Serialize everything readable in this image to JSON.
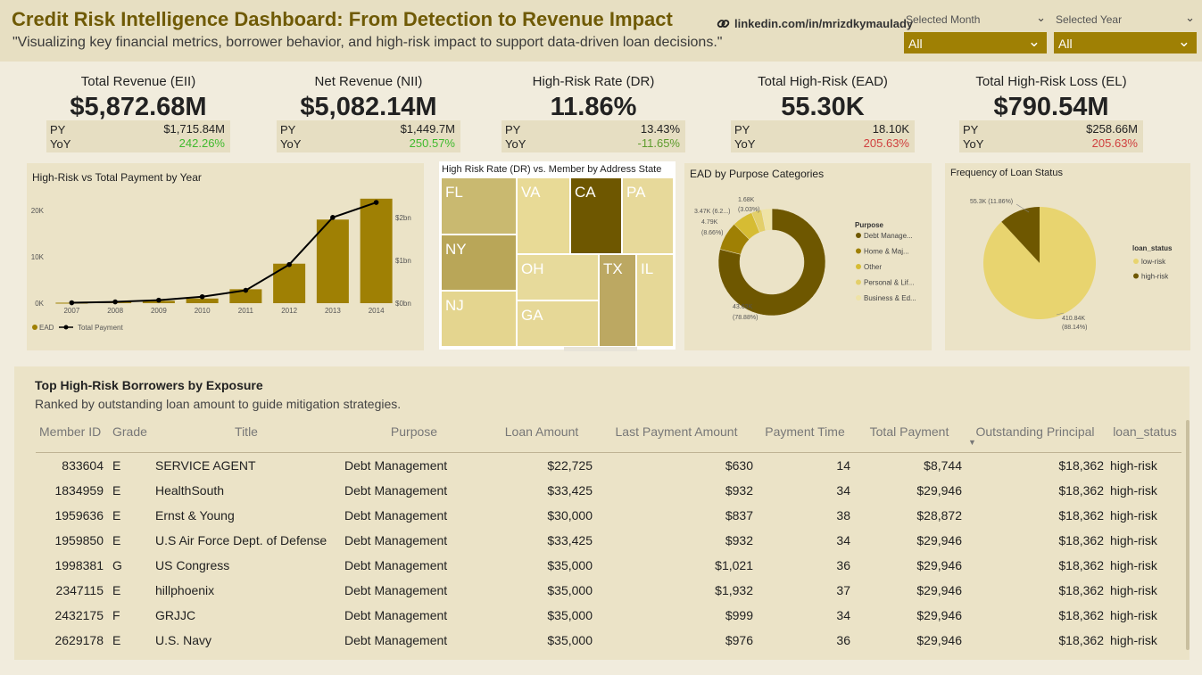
{
  "header": {
    "title": "Credit Risk Intelligence Dashboard: From Detection to Revenue Impact",
    "subtitle": "\"Visualizing key financial metrics, borrower behavior, and high-risk impact to support data-driven loan decisions.\"",
    "link": "linkedin.com/in/mrizdkymaulady"
  },
  "filters": {
    "month": {
      "label": "Selected Month",
      "value": "All"
    },
    "year": {
      "label": "Selected Year",
      "value": "All"
    }
  },
  "kpis": [
    {
      "title": "Total Revenue (EII)",
      "value": "$5,872.68M",
      "py_label": "PY",
      "py": "$1,715.84M",
      "yoy_label": "YoY",
      "yoy": "242.26%",
      "yoy_color": "#3fba2d"
    },
    {
      "title": "Net Revenue (NII)",
      "value": "$5,082.14M",
      "py_label": "PY",
      "py": "$1,449.7M",
      "yoy_label": "YoY",
      "yoy": "250.57%",
      "yoy_color": "#3fba2d"
    },
    {
      "title": "High-Risk Rate (DR)",
      "value": "11.86%",
      "py_label": "PY",
      "py": "13.43%",
      "yoy_label": "YoY",
      "yoy": "-11.65%",
      "yoy_color": "#5e9c2e"
    },
    {
      "title": "Total High-Risk (EAD)",
      "value": "55.30K",
      "py_label": "PY",
      "py": "18.10K",
      "yoy_label": "YoY",
      "yoy": "205.63%",
      "yoy_color": "#d0403f"
    },
    {
      "title": "Total High-Risk Loss (EL)",
      "value": "$790.54M",
      "py_label": "PY",
      "py": "$258.66M",
      "yoy_label": "YoY",
      "yoy": "205.63%",
      "yoy_color": "#d0403f"
    }
  ],
  "charts": {
    "combo_title": "High-Risk vs Total Payment by Year",
    "treemap_title": "High Risk Rate (DR) vs. Member by Address State",
    "donut_title": "EAD by Purpose Categories",
    "pie_title": "Frequency of Loan Status"
  },
  "chart_data": [
    {
      "type": "bar",
      "title": "High-Risk vs Total Payment by Year",
      "categories": [
        "2007",
        "2008",
        "2009",
        "2010",
        "2011",
        "2012",
        "2013",
        "2014"
      ],
      "series": [
        {
          "name": "EAD",
          "type": "bar",
          "values": [
            100,
            300,
            500,
            1000,
            3000,
            8500,
            18000,
            22500
          ]
        },
        {
          "name": "Total Payment",
          "type": "line",
          "values": [
            0.01,
            0.03,
            0.07,
            0.15,
            0.3,
            0.9,
            2.0,
            2.35
          ]
        }
      ],
      "y_left_ticks": [
        "0K",
        "10K",
        "20K"
      ],
      "y_left_range": [
        0,
        24000
      ],
      "y_right_ticks": [
        "$0bn",
        "$1bn",
        "$2bn"
      ],
      "y_right_range": [
        0,
        2.6
      ],
      "colors": {
        "bar": "#9f8004",
        "line": "#000000"
      },
      "legend": "bottom-left"
    },
    {
      "type": "treemap",
      "title": "High Risk Rate (DR) vs. Member by Address State",
      "cells": [
        {
          "label": "FL",
          "color": "#c9b970"
        },
        {
          "label": "VA",
          "color": "#e8da96"
        },
        {
          "label": "CA",
          "color": "#6e5700"
        },
        {
          "label": "PA",
          "color": "#e7d99a"
        },
        {
          "label": "NY",
          "color": "#b9a658"
        },
        {
          "label": "OH",
          "color": "#e7da9b"
        },
        {
          "label": "TX",
          "color": "#bca862"
        },
        {
          "label": "IL",
          "color": "#e6d897"
        },
        {
          "label": "NJ",
          "color": "#e4d58f"
        },
        {
          "label": "GA",
          "color": "#e6d897"
        }
      ]
    },
    {
      "type": "pie",
      "title": "EAD by Purpose Categories",
      "donut": true,
      "legend_title": "Purpose",
      "slices": [
        {
          "name": "Debt Manage...",
          "value": 43.63,
          "label": "43.63K",
          "pct": "(78.88%)",
          "color": "#6e5700"
        },
        {
          "name": "Home & Maj...",
          "value": 4.79,
          "label": "4.79K",
          "pct": "(8.66%)",
          "color": "#9f8004"
        },
        {
          "name": "Other",
          "value": 3.47,
          "label": "3.47K (6.2...)",
          "pct": "",
          "color": "#d6bc33"
        },
        {
          "name": "Personal & Lif...",
          "value": 1.68,
          "label": "1.68K",
          "pct": "(3.03%)",
          "color": "#e3cf6a"
        },
        {
          "name": "Business & Ed...",
          "value": 1.73,
          "label": "",
          "pct": "",
          "color": "#efe3a6"
        }
      ]
    },
    {
      "type": "pie",
      "title": "Frequency of Loan Status",
      "legend_title": "loan_status",
      "slices": [
        {
          "name": "low-risk",
          "value": 410.84,
          "label": "410.84K",
          "pct": "(88.14%)",
          "color": "#e8d46f"
        },
        {
          "name": "high-risk",
          "value": 55.3,
          "label": "55.3K (11.86%)",
          "pct": "",
          "color": "#6e5700"
        }
      ]
    }
  ],
  "table": {
    "title": "Top High-Risk Borrowers by Exposure",
    "subtitle": "Ranked by outstanding loan amount to guide mitigation strategies.",
    "columns": [
      "Member ID",
      "Grade",
      "Title",
      "Purpose",
      "Loan Amount",
      "Last Payment Amount",
      "Payment Time",
      "Total Payment",
      "Outstanding Principal",
      "loan_status"
    ],
    "rows": [
      [
        "833604",
        "E",
        "SERVICE AGENT",
        "Debt Management",
        "$22,725",
        "$630",
        "14",
        "$8,744",
        "$18,362",
        "high-risk"
      ],
      [
        "1834959",
        "E",
        "HealthSouth",
        "Debt Management",
        "$33,425",
        "$932",
        "34",
        "$29,946",
        "$18,362",
        "high-risk"
      ],
      [
        "1959636",
        "E",
        "Ernst & Young",
        "Debt Management",
        "$30,000",
        "$837",
        "38",
        "$28,872",
        "$18,362",
        "high-risk"
      ],
      [
        "1959850",
        "E",
        "U.S Air Force Dept. of Defense",
        "Debt Management",
        "$33,425",
        "$932",
        "34",
        "$29,946",
        "$18,362",
        "high-risk"
      ],
      [
        "1998381",
        "G",
        "US Congress",
        "Debt Management",
        "$35,000",
        "$1,021",
        "36",
        "$29,946",
        "$18,362",
        "high-risk"
      ],
      [
        "2347115",
        "E",
        "hillphoenix",
        "Debt Management",
        "$35,000",
        "$1,932",
        "37",
        "$29,946",
        "$18,362",
        "high-risk"
      ],
      [
        "2432175",
        "F",
        "GRJJC",
        "Debt Management",
        "$35,000",
        "$999",
        "34",
        "$29,946",
        "$18,362",
        "high-risk"
      ],
      [
        "2629178",
        "E",
        "U.S. Navy",
        "Debt Management",
        "$35,000",
        "$976",
        "36",
        "$29,946",
        "$18,362",
        "high-risk"
      ]
    ]
  }
}
